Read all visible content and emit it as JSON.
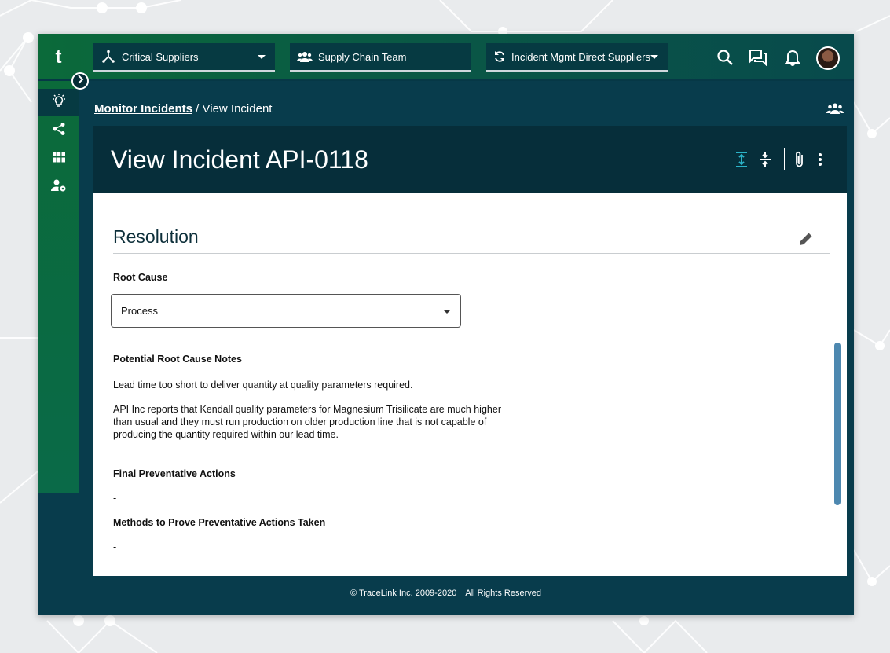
{
  "app": {
    "logo": "t"
  },
  "topbar": {
    "selectors": [
      {
        "label": "Critical Suppliers",
        "icon": "network-icon",
        "has_caret": true
      },
      {
        "label": "Supply Chain Team",
        "icon": "team-icon",
        "has_caret": false
      },
      {
        "label": "Incident Mgmt Direct Suppliers",
        "icon": "sync-icon",
        "has_caret": true
      }
    ],
    "icons": [
      "search-icon",
      "chat-icon",
      "bell-icon",
      "avatar"
    ]
  },
  "sidebar": {
    "items": [
      "lightbulb-icon",
      "share-icon",
      "grid-icon",
      "user-settings-icon"
    ],
    "active_index": 0
  },
  "breadcrumb": {
    "link": "Monitor Incidents",
    "separator": " / ",
    "current": "View Incident"
  },
  "header": {
    "title": "View Incident API-0118"
  },
  "resolution": {
    "title": "Resolution",
    "root_cause_label": "Root Cause",
    "root_cause_value": "Process",
    "notes_label": "Potential Root Cause Notes",
    "notes_p1": "Lead time too short to deliver quantity at quality parameters required.",
    "notes_p2_l1": "API Inc reports that Kendall quality parameters for Magnesium Trisilicate are much higher",
    "notes_p2_l2": "than usual and they must run production on older production line that is not capable of",
    "notes_p2_l3": "producing the quantity required within our lead time.",
    "final_actions_label": "Final Preventative Actions",
    "final_actions_value": "-",
    "methods_label": "Methods to Prove Preventative Actions Taken",
    "methods_value": "-"
  },
  "footer": {
    "copyright": "© TraceLink Inc. 2009-2020",
    "rights": "All Rights Reserved"
  },
  "colors": {
    "app_bg": "#083c4c",
    "accent_green": "#0b6a3a",
    "header_card": "#062e3a",
    "accent_teal": "#2bb3c8",
    "scrollbar": "#4d88b0"
  }
}
